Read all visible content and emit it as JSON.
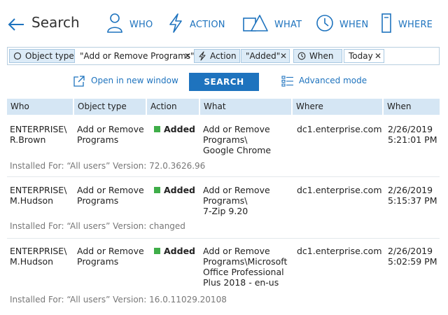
{
  "header": {
    "title": "Search",
    "nav": [
      {
        "label": "WHO",
        "icon": "user-icon"
      },
      {
        "label": "ACTION",
        "icon": "lightning-icon"
      },
      {
        "label": "WHAT",
        "icon": "shapes-icon"
      },
      {
        "label": "WHEN",
        "icon": "clock-icon"
      },
      {
        "label": "WHERE",
        "icon": "server-icon"
      }
    ]
  },
  "filters": [
    {
      "label": "Object type",
      "value": "\"Add or Remove Programs\"",
      "icon": "circle-icon"
    },
    {
      "label": "Action",
      "value": "\"Added\"",
      "icon": "lightning-icon"
    },
    {
      "label": "When",
      "value": "Today",
      "icon": "clock-icon"
    }
  ],
  "actions": {
    "open_new_window": "Open in new window",
    "search": "SEARCH",
    "advanced_mode": "Advanced mode"
  },
  "table": {
    "columns": [
      "Who",
      "Object type",
      "Action",
      "What",
      "Where",
      "When"
    ],
    "rows": [
      {
        "who": "ENTERPRISE\\\nR.Brown",
        "object_type": "Add or Remove\nPrograms",
        "action": "Added",
        "what": "Add or Remove\nPrograms\\\nGoogle Chrome",
        "where": "dc1.enterprise.com",
        "when": "2/26/2019\n5:21:01 PM",
        "details": "Installed For: “All users” Version: 72.0.3626.96"
      },
      {
        "who": "ENTERPRISE\\\nM.Hudson",
        "object_type": "Add or Remove\nPrograms",
        "action": "Added",
        "what": "Add or Remove\nPrograms\\\n7-Zip 9.20",
        "where": "dc1.enterprise.com",
        "when": "2/26/2019\n5:15:37 PM",
        "details": "Installed For: “All users” Version: changed"
      },
      {
        "who": "ENTERPRISE\\\nM.Hudson",
        "object_type": "Add or Remove\nPrograms",
        "action": "Added",
        "what": "Add or Remove\nPrograms\\Microsoft\nOffice Professional\nPlus 2018 - en-us",
        "where": "dc1.enterprise.com",
        "when": "2/26/2019\n5:02:59 PM",
        "details": "Installed For: “All users” Version: 16.0.11029.20108"
      }
    ]
  },
  "colors": {
    "accent": "#1e73be",
    "header_bg": "#d5e6f4",
    "chip_bg": "#dcebf7",
    "added": "#3fae49"
  }
}
